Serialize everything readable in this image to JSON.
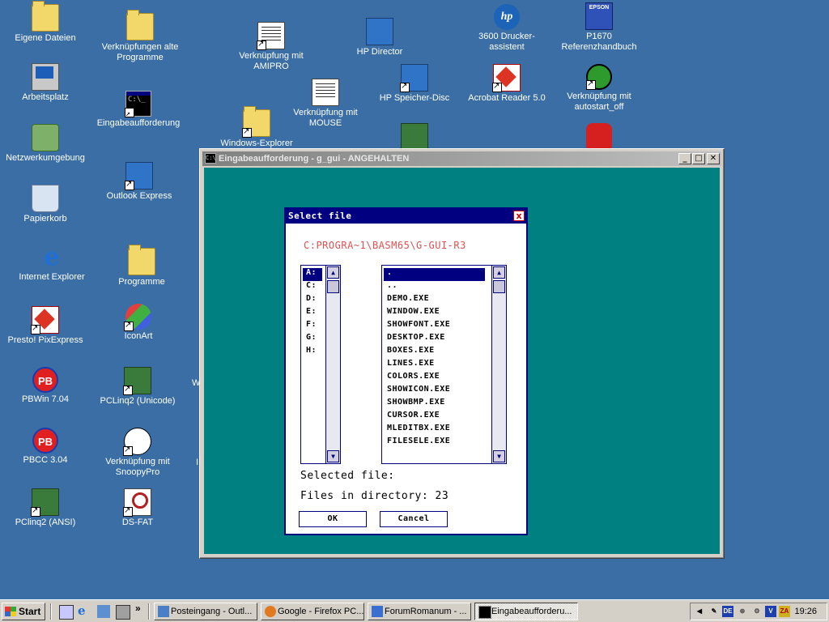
{
  "desktop": {
    "icons": [
      {
        "label": "Eigene Dateien",
        "icon": "folder-documents-icon"
      },
      {
        "label": "Arbeitsplatz",
        "icon": "my-computer-icon"
      },
      {
        "label": "Netzwerkumgebung",
        "icon": "network-icon"
      },
      {
        "label": "Papierkorb",
        "icon": "recycle-bin-icon"
      },
      {
        "label": "Internet Explorer",
        "icon": "internet-explorer-icon"
      },
      {
        "label": "Presto! PixExpress",
        "icon": "pixexpress-icon"
      },
      {
        "label": "PBWin 7.04",
        "icon": "pb-icon"
      },
      {
        "label": "PBCC 3.04",
        "icon": "pb-icon"
      },
      {
        "label": "PClinq2 (ANSI)",
        "icon": "pclinq-icon"
      },
      {
        "label": "Verknüpfungen alte Programme",
        "icon": "folder-icon"
      },
      {
        "label": "Eingabeaufforderung",
        "icon": "command-prompt-icon"
      },
      {
        "label": "Outlook Express",
        "icon": "outlook-express-icon"
      },
      {
        "label": "Programme",
        "icon": "folder-icon"
      },
      {
        "label": "IconArt",
        "icon": "iconart-icon"
      },
      {
        "label": "PCLinq2 (Unicode)",
        "icon": "pclinq-icon"
      },
      {
        "label": "Verknüpfung mit SnoopyPro",
        "icon": "snoopy-icon"
      },
      {
        "label": "DS-FAT",
        "icon": "ds-fat-icon"
      },
      {
        "label": "Verknüpfung mit AMIPRO",
        "icon": "amipro-icon"
      },
      {
        "label": "Windows-Explorer",
        "icon": "windows-explorer-icon"
      },
      {
        "label": "Verknüpfung mit MOUSE",
        "icon": "document-icon"
      },
      {
        "label": "HP Director",
        "icon": "hp-director-icon"
      },
      {
        "label": "HP Speicher-Disc",
        "icon": "hp-disc-icon"
      },
      {
        "label": "3600 Drucker-assistent",
        "icon": "hp-icon"
      },
      {
        "label": "Acrobat Reader 5.0",
        "icon": "acrobat-icon"
      },
      {
        "label": "P1670 Referenzhandbuch",
        "icon": "epson-icon"
      },
      {
        "label": "Verknüpfung mit autostart_off",
        "icon": "autostart-icon"
      }
    ],
    "partial_labels": [
      "W",
      "I"
    ]
  },
  "console_window": {
    "title": "Eingabeaufforderung - g_gui - ANGEHALTEN",
    "icon_text": "C:\\",
    "minimize": "_",
    "maximize": "□",
    "close": "✕"
  },
  "dialog": {
    "title": "Select file",
    "close": "x",
    "path": "C:PROGRA~1\\BASM65\\G-GUI-R3",
    "drives": [
      "A:",
      "C:",
      "D:",
      "E:",
      "F:",
      "G:",
      "H:"
    ],
    "selected_drive": "A:",
    "files": [
      ".",
      "..",
      "DEMO.EXE",
      "WINDOW.EXE",
      "SHOWFONT.EXE",
      "DESKTOP.EXE",
      "BOXES.EXE",
      "LINES.EXE",
      "COLORS.EXE",
      "SHOWICON.EXE",
      "SHOWBMP.EXE",
      "CURSOR.EXE",
      "MLEDITBX.EXE",
      "FILESELE.EXE"
    ],
    "selected_file_index": 0,
    "selected_file_label": "Selected file:",
    "files_count_label": "Files in directory: 23",
    "ok_label": "OK",
    "cancel_label": "Cancel",
    "scroll_up": "▲",
    "scroll_down": "▼"
  },
  "taskbar": {
    "start_label": "Start",
    "quick_launch_more": "»",
    "tasks": [
      {
        "label": "Posteingang - Outl...",
        "icon": "outlook-icon",
        "active": false
      },
      {
        "label": "Google - Firefox PC...",
        "icon": "firefox-icon",
        "active": false
      },
      {
        "label": "ForumRomanum - ...",
        "icon": "ie-window-icon",
        "active": false
      },
      {
        "label": "Eingabeaufforderu...",
        "icon": "console-icon",
        "active": true
      }
    ],
    "tray": {
      "language": "DE",
      "clock": "19:26"
    }
  }
}
